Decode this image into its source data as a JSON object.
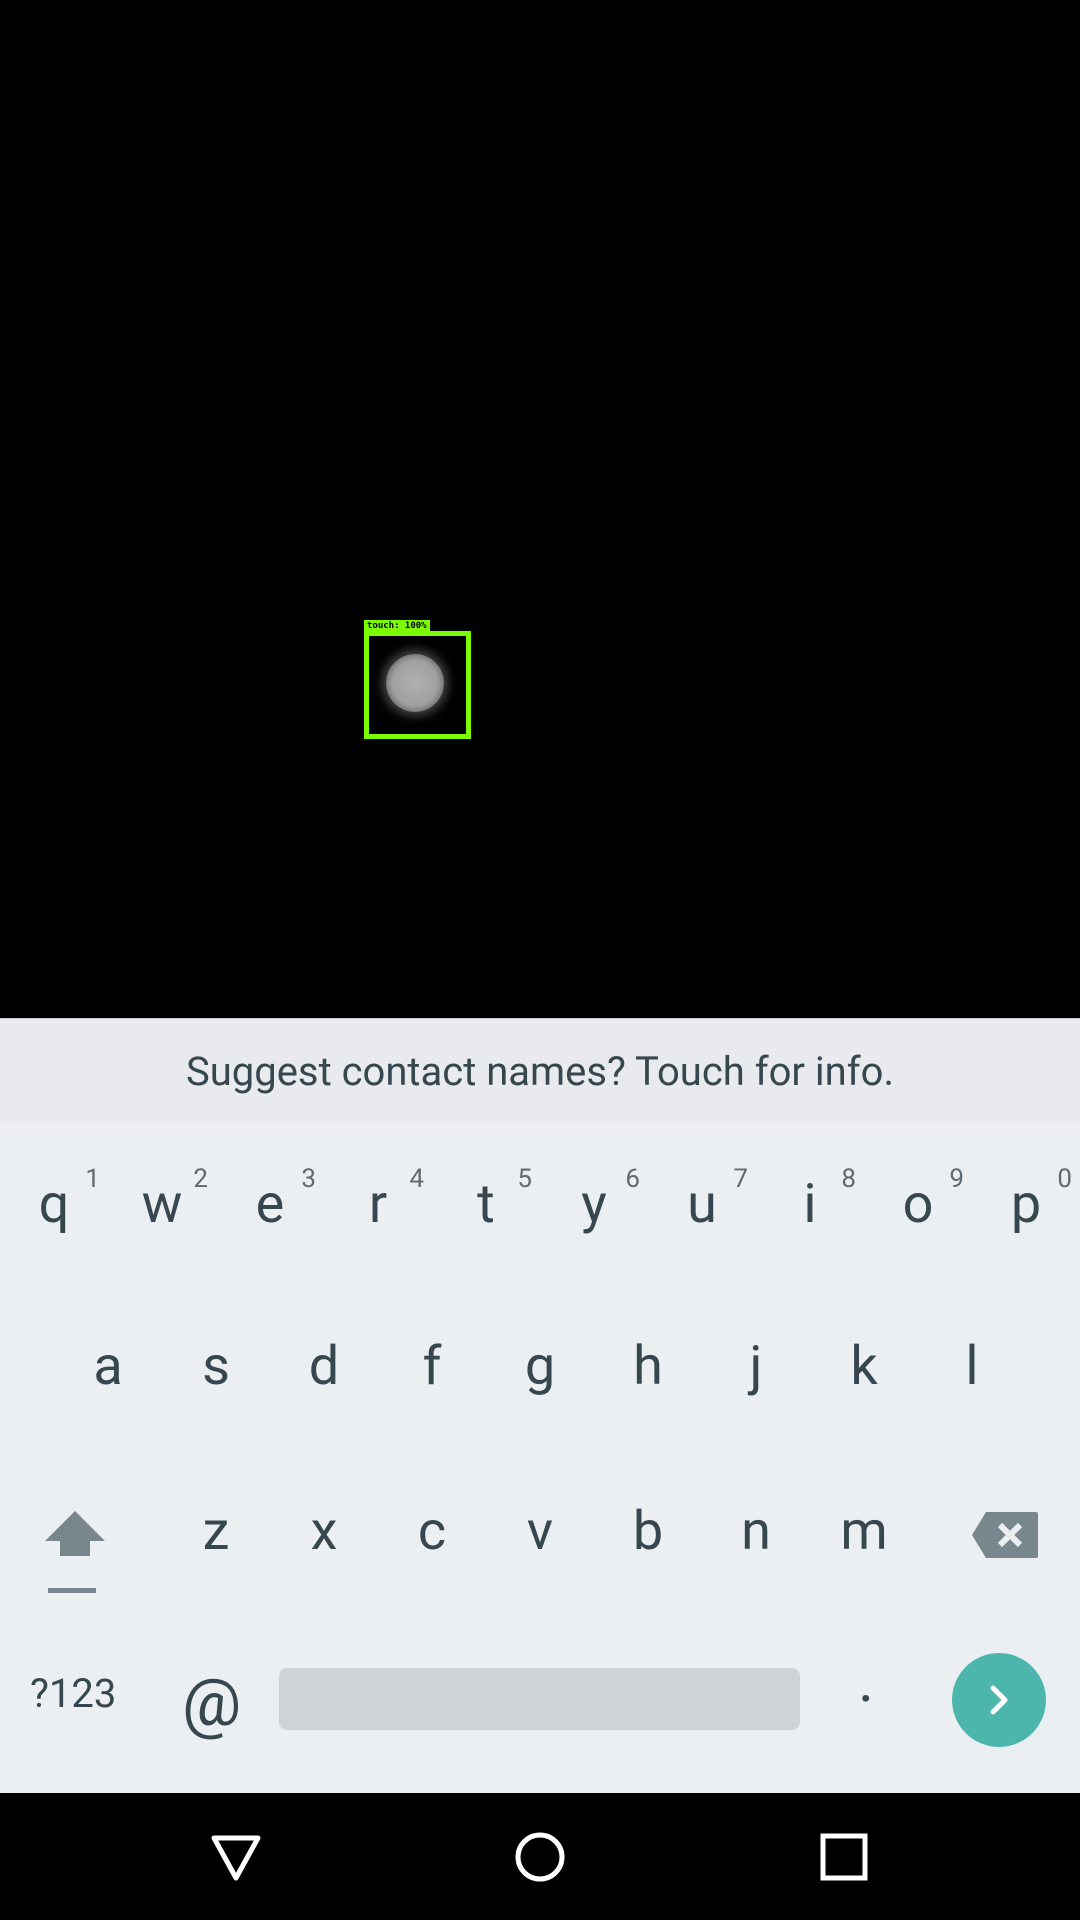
{
  "detection": {
    "label": "touch: 100%"
  },
  "suggestion": {
    "text": "Suggest contact names? Touch for info."
  },
  "keyboard": {
    "row1": [
      {
        "key": "q",
        "hint": "1"
      },
      {
        "key": "w",
        "hint": "2"
      },
      {
        "key": "e",
        "hint": "3"
      },
      {
        "key": "r",
        "hint": "4"
      },
      {
        "key": "t",
        "hint": "5"
      },
      {
        "key": "y",
        "hint": "6"
      },
      {
        "key": "u",
        "hint": "7"
      },
      {
        "key": "i",
        "hint": "8"
      },
      {
        "key": "o",
        "hint": "9"
      },
      {
        "key": "p",
        "hint": "0"
      }
    ],
    "row2": [
      "a",
      "s",
      "d",
      "f",
      "g",
      "h",
      "j",
      "k",
      "l"
    ],
    "row3": [
      "z",
      "x",
      "c",
      "v",
      "b",
      "n",
      "m"
    ],
    "symbols_label": "?123",
    "at_label": "@",
    "period_label": ".",
    "accent_color": "#4db6ac"
  },
  "navbar": {
    "icons": [
      "back-icon",
      "home-icon",
      "recents-icon"
    ]
  }
}
